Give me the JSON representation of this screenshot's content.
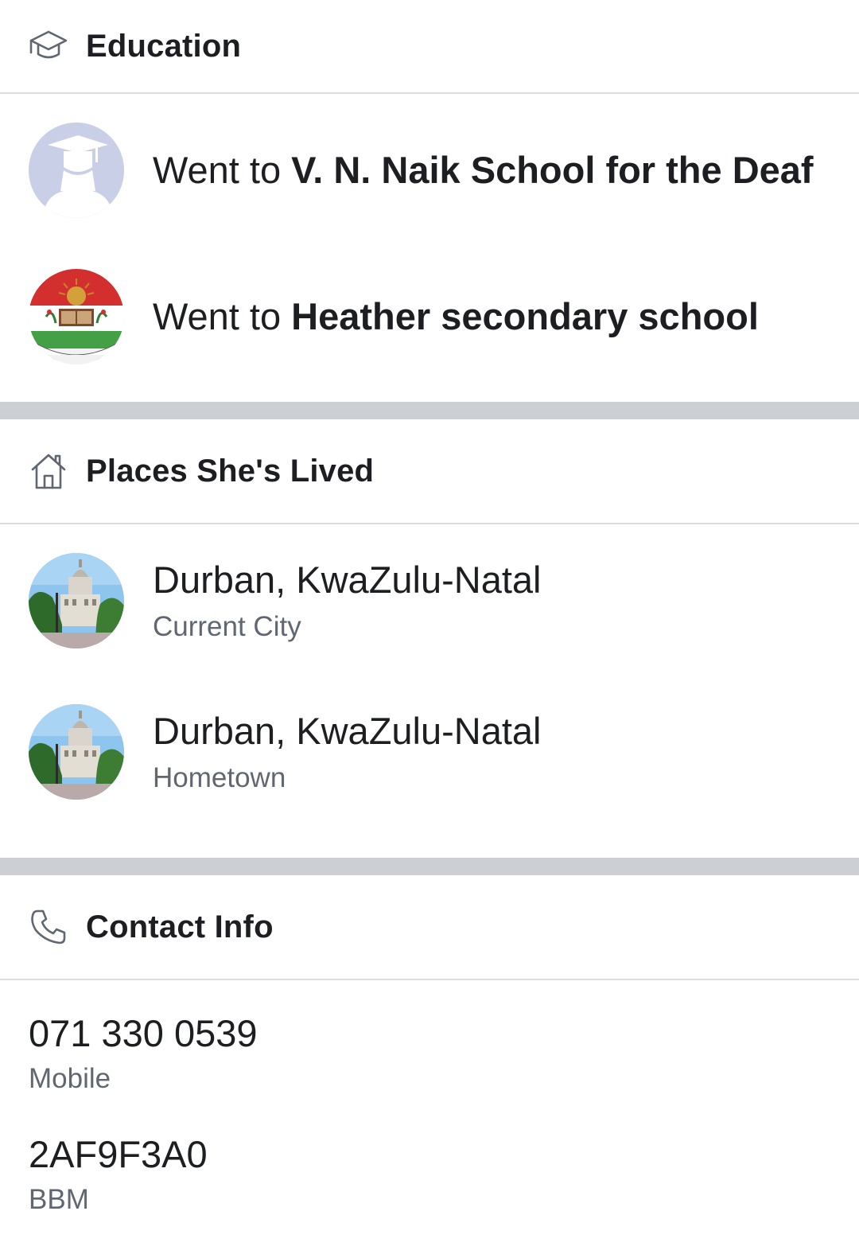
{
  "education": {
    "title": "Education",
    "icon": "graduation-cap-icon",
    "items": [
      {
        "prefix": "Went to ",
        "school": "V. N. Naik School for the Deaf",
        "avatar": "graduate-silhouette-avatar"
      },
      {
        "prefix": "Went to ",
        "school": "Heather secondary school",
        "avatar": "school-crest-avatar"
      }
    ]
  },
  "places": {
    "title": "Places She's Lived",
    "icon": "home-icon",
    "items": [
      {
        "city": "Durban, KwaZulu-Natal",
        "label": "Current City",
        "avatar": "city-hall-photo"
      },
      {
        "city": "Durban, KwaZulu-Natal",
        "label": "Hometown",
        "avatar": "city-hall-photo"
      }
    ]
  },
  "contact": {
    "title": "Contact Info",
    "icon": "phone-icon",
    "items": [
      {
        "value": "071 330 0539",
        "label": "Mobile"
      },
      {
        "value": "2AF9F3A0",
        "label": "BBM"
      }
    ]
  },
  "colors": {
    "text": "#1c1e21",
    "secondary_text": "#606770",
    "divider": "#dadde1",
    "section_gap": "#ccd0d5"
  }
}
